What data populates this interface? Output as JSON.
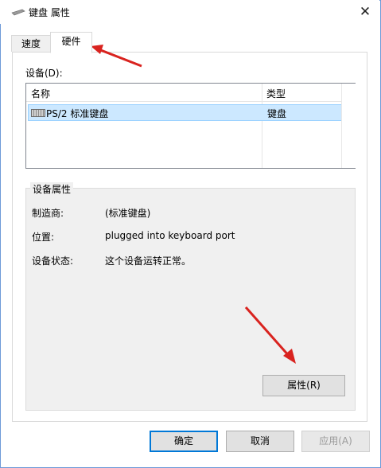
{
  "window": {
    "title": "键盘 属性",
    "close_label": "✕",
    "icon": "keyboard-icon"
  },
  "tabs": [
    {
      "label": "速度",
      "selected": false
    },
    {
      "label": "硬件",
      "selected": true
    }
  ],
  "devices": {
    "label": "设备(D):",
    "columns": [
      "名称",
      "类型"
    ],
    "rows": [
      {
        "name": "PS/2 标准键盘",
        "type": "键盘",
        "icon": "keyboard-icon",
        "selected": true
      }
    ]
  },
  "device_properties": {
    "title": "设备属性",
    "manufacturer_label": "制造商:",
    "manufacturer_value": "(标准键盘)",
    "location_label": "位置:",
    "location_value": "plugged into keyboard port",
    "status_label": "设备状态:",
    "status_value": "这个设备运转正常。",
    "properties_button": "属性(R)"
  },
  "footer": {
    "ok": "确定",
    "cancel": "取消",
    "apply": "应用(A)"
  },
  "colors": {
    "annotation_arrow": "#d9231f",
    "selection": "#cce8ff",
    "focus_border": "#0078d7"
  }
}
